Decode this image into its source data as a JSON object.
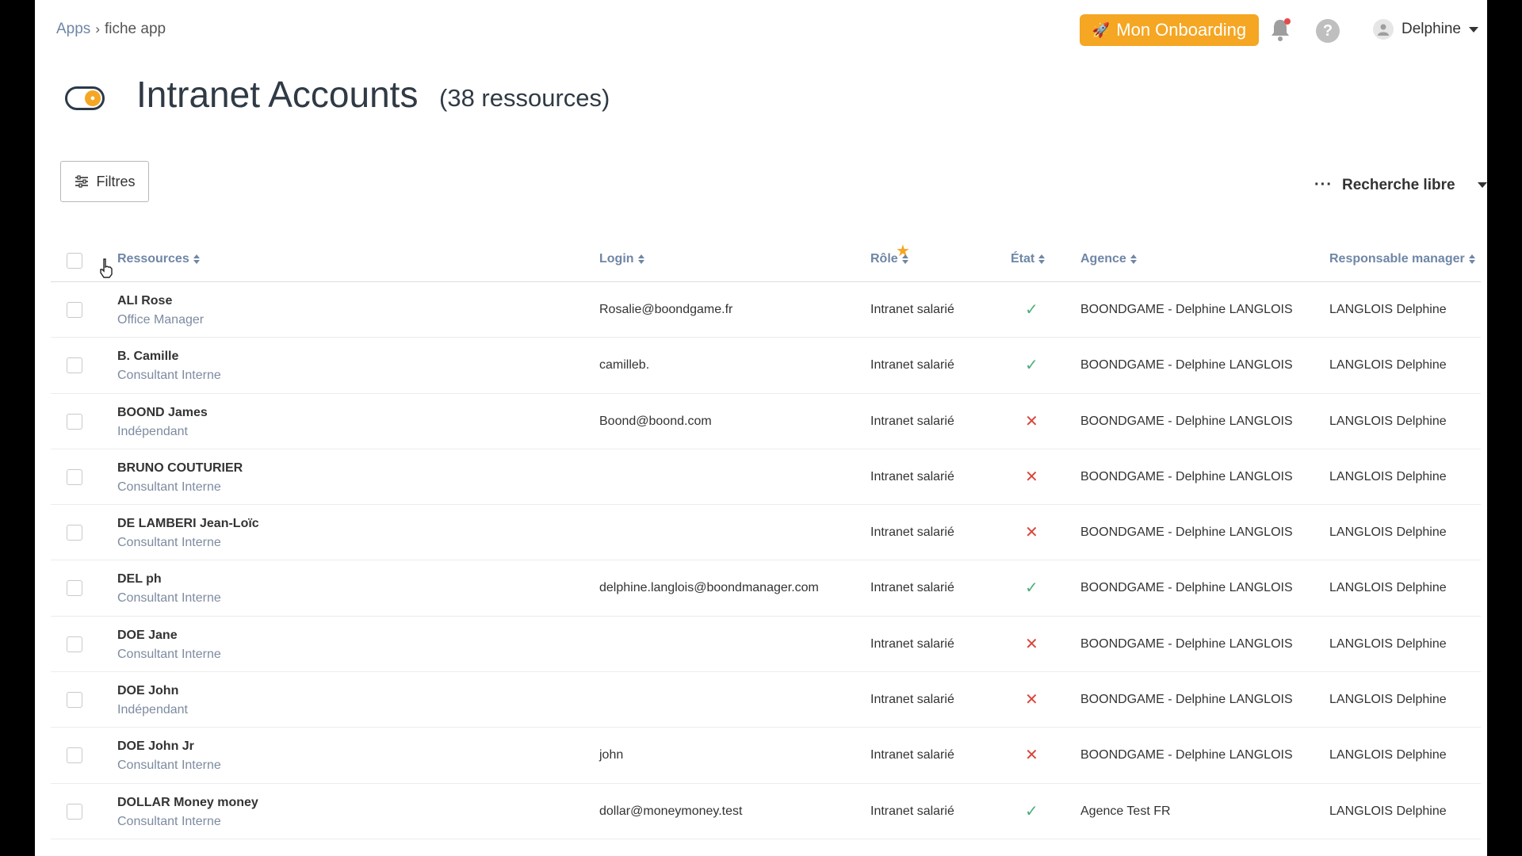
{
  "breadcrumb": {
    "root": "Apps",
    "current": "fiche app"
  },
  "topbar": {
    "onboarding_label": "Mon Onboarding",
    "user_name": "Delphine",
    "help_label": "?"
  },
  "header": {
    "title": "Intranet Accounts",
    "count": "(38 ressources)"
  },
  "toolbar": {
    "filters_label": "Filtres",
    "search_label": "Recherche libre"
  },
  "table": {
    "columns": {
      "resources": "Ressources",
      "login": "Login",
      "role": "Rôle",
      "state": "État",
      "agency": "Agence",
      "manager": "Responsable manager"
    },
    "rows": [
      {
        "name": "ALI Rose",
        "type": "Office Manager",
        "login": "Rosalie@boondgame.fr",
        "role": "Intranet salarié",
        "state": "active",
        "agency": "BOONDGAME - Delphine LANGLOIS",
        "manager": "LANGLOIS Delphine"
      },
      {
        "name": "B. Camille",
        "type": "Consultant Interne",
        "login": "camilleb.",
        "role": "Intranet salarié",
        "state": "active",
        "agency": "BOONDGAME - Delphine LANGLOIS",
        "manager": "LANGLOIS Delphine"
      },
      {
        "name": "BOOND James",
        "type": "Indépendant",
        "login": "Boond@boond.com",
        "role": "Intranet salarié",
        "state": "inactive",
        "agency": "BOONDGAME - Delphine LANGLOIS",
        "manager": "LANGLOIS Delphine"
      },
      {
        "name": "BRUNO COUTURIER",
        "type": "Consultant Interne",
        "login": "",
        "role": "Intranet salarié",
        "state": "inactive",
        "agency": "BOONDGAME - Delphine LANGLOIS",
        "manager": "LANGLOIS Delphine"
      },
      {
        "name": "DE LAMBERI Jean-Loïc",
        "type": "Consultant Interne",
        "login": "",
        "role": "Intranet salarié",
        "state": "inactive",
        "agency": "BOONDGAME - Delphine LANGLOIS",
        "manager": "LANGLOIS Delphine"
      },
      {
        "name": "DEL ph",
        "type": "Consultant Interne",
        "login": "delphine.langlois@boondmanager.com",
        "role": "Intranet salarié",
        "state": "active",
        "agency": "BOONDGAME - Delphine LANGLOIS",
        "manager": "LANGLOIS Delphine"
      },
      {
        "name": "DOE Jane",
        "type": "Consultant Interne",
        "login": "",
        "role": "Intranet salarié",
        "state": "inactive",
        "agency": "BOONDGAME - Delphine LANGLOIS",
        "manager": "LANGLOIS Delphine"
      },
      {
        "name": "DOE John",
        "type": "Indépendant",
        "login": "",
        "role": "Intranet salarié",
        "state": "inactive",
        "agency": "BOONDGAME - Delphine LANGLOIS",
        "manager": "LANGLOIS Delphine"
      },
      {
        "name": "DOE John Jr",
        "type": "Consultant Interne",
        "login": "john",
        "role": "Intranet salarié",
        "state": "inactive",
        "agency": "BOONDGAME - Delphine LANGLOIS",
        "manager": "LANGLOIS Delphine"
      },
      {
        "name": "DOLLAR Money money",
        "type": "Consultant Interne",
        "login": "dollar@moneymoney.test",
        "role": "Intranet salarié",
        "state": "active",
        "agency": "Agence Test FR",
        "manager": "LANGLOIS Delphine"
      }
    ]
  },
  "colors": {
    "accent": "#f5a623",
    "link": "#6f86a6",
    "active": "#4caf7d",
    "inactive": "#d9463a"
  },
  "icons": {
    "bell": "bell-icon",
    "help": "help-icon",
    "user": "user-icon",
    "filters": "sliders-icon",
    "state_active": "check-icon",
    "state_inactive": "cross-icon"
  }
}
